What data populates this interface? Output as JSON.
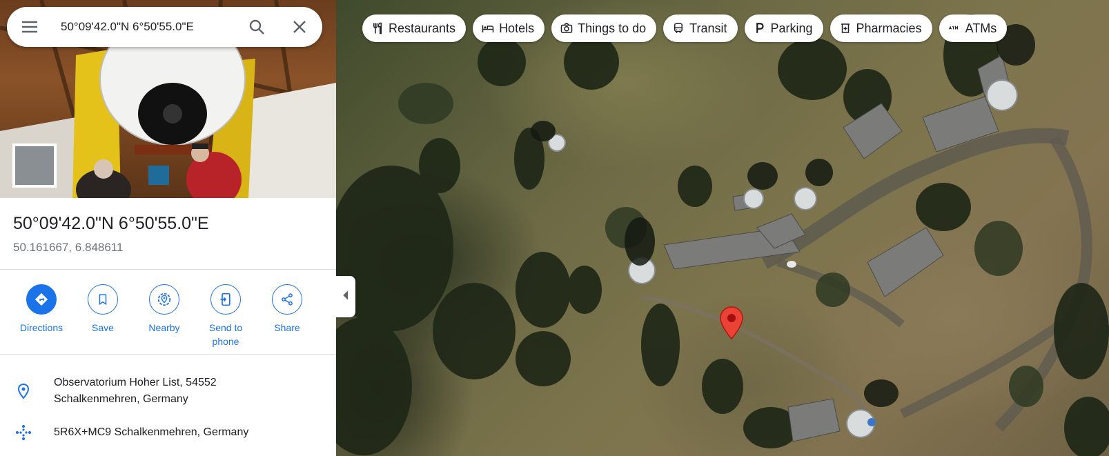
{
  "search": {
    "value": "50°09'42.0\"N 6°50'55.0\"E",
    "menu_icon": "hamburger-menu-icon",
    "search_icon": "search-icon",
    "close_icon": "close-icon"
  },
  "place": {
    "title": "50°09'42.0\"N 6°50'55.0\"E",
    "coordinates": "50.161667, 6.848611"
  },
  "actions": [
    {
      "label": "Directions",
      "icon": "directions-icon"
    },
    {
      "label": "Save",
      "icon": "bookmark-icon"
    },
    {
      "label": "Nearby",
      "icon": "nearby-icon"
    },
    {
      "label": "Send to",
      "label2": "phone",
      "icon": "send-to-phone-icon"
    },
    {
      "label": "Share",
      "icon": "share-icon"
    }
  ],
  "info": {
    "address_line1": "Observatorium Hoher List, 54552",
    "address_line2": "Schalkenmehren, Germany",
    "plus_code": "5R6X+MC9 Schalkenmehren, Germany"
  },
  "chips": [
    {
      "label": "Restaurants",
      "icon": "fork-knife-icon"
    },
    {
      "label": "Hotels",
      "icon": "bed-icon"
    },
    {
      "label": "Things to do",
      "icon": "camera-icon"
    },
    {
      "label": "Transit",
      "icon": "train-icon"
    },
    {
      "label": "Parking",
      "icon": "parking-icon"
    },
    {
      "label": "Pharmacies",
      "icon": "pharmacy-icon"
    },
    {
      "label": "ATMs",
      "icon": "atm-icon"
    }
  ],
  "colors": {
    "accent": "#1a73e8",
    "pin": "#ea4335",
    "text_primary": "#202124",
    "text_secondary": "#70757a"
  }
}
